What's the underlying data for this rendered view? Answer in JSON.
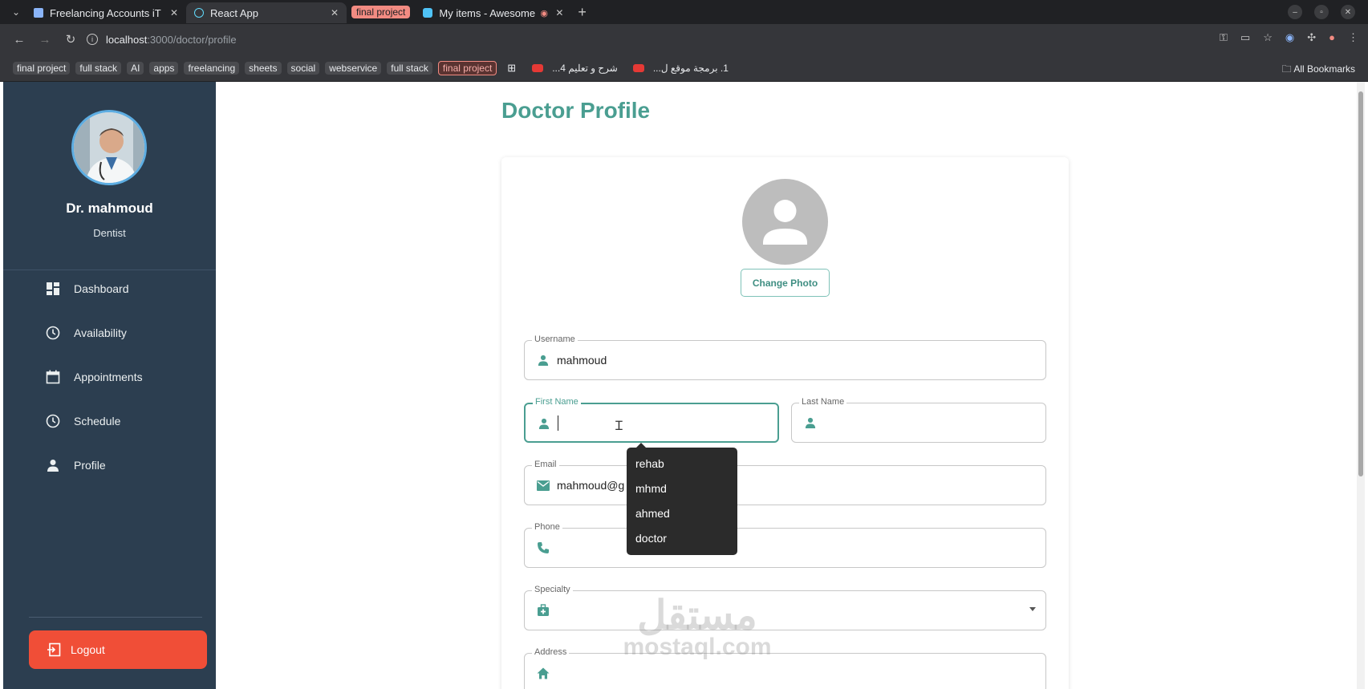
{
  "browser": {
    "tabs": [
      {
        "label": "Freelancing Accounts iT",
        "active": false
      },
      {
        "label": "React App",
        "active": true
      },
      {
        "label": "My items - Awesome",
        "active": false
      }
    ],
    "tab_group_label": "final project",
    "url_host": "localhost",
    "url_path": ":3000/doctor/profile",
    "bookmarks": [
      "final project",
      "full stack",
      "AI",
      "apps",
      "freelancing",
      "sheets",
      "social",
      "webservice",
      "full stack",
      "final project"
    ],
    "bookmark_links": [
      "شرح و تعليم 4...",
      "1. برمجة موقع ل..."
    ],
    "all_bookmarks": "All Bookmarks"
  },
  "sidebar": {
    "doctor_name": "Dr. mahmoud",
    "doctor_specialty": "Dentist",
    "nav": [
      {
        "label": "Dashboard",
        "icon": "dashboard-icon"
      },
      {
        "label": "Availability",
        "icon": "clock-icon"
      },
      {
        "label": "Appointments",
        "icon": "calendar-icon"
      },
      {
        "label": "Schedule",
        "icon": "clock-icon"
      },
      {
        "label": "Profile",
        "icon": "person-icon"
      }
    ],
    "logout_label": "Logout"
  },
  "main": {
    "page_title": "Doctor Profile",
    "change_photo_label": "Change Photo",
    "fields": {
      "username": {
        "label": "Username",
        "value": "mahmoud"
      },
      "first_name": {
        "label": "First Name",
        "value": ""
      },
      "last_name": {
        "label": "Last Name",
        "value": ""
      },
      "email": {
        "label": "Email",
        "value": "mahmoud@g"
      },
      "phone": {
        "label": "Phone",
        "value": ""
      },
      "specialty": {
        "label": "Specialty",
        "value": ""
      },
      "address": {
        "label": "Address",
        "value": ""
      }
    },
    "autocomplete_options": [
      "rehab",
      "mhmd",
      "ahmed",
      "doctor"
    ]
  },
  "watermark": {
    "arabic": "مستقل",
    "latin": "mostaql.com"
  },
  "colors": {
    "accent": "#4a9e91",
    "sidebar": "#2c3e50",
    "logout": "#f04e37"
  }
}
